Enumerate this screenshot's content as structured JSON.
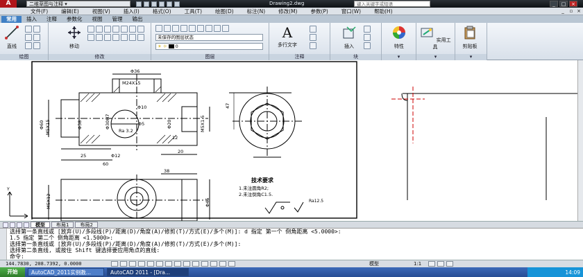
{
  "titlebar": {
    "workspace": "二维草图与注释",
    "doc_title": "Drawing2.dwg",
    "search_placeholder": "键入关键字或短语",
    "min": "_",
    "max": "□",
    "close": "×"
  },
  "menubar": {
    "items": [
      "文件(F)",
      "编辑(E)",
      "视图(V)",
      "插入(I)",
      "格式(O)",
      "工具(T)",
      "绘图(D)",
      "标注(N)",
      "修改(M)",
      "参数(P)",
      "窗口(W)",
      "帮助(H)"
    ]
  },
  "ribbon_tabs": [
    "常用",
    "插入",
    "注释",
    "参数化",
    "视图",
    "管理",
    "输出"
  ],
  "ribbon": {
    "draw": {
      "line": "直线",
      "title": "绘图"
    },
    "modify": {
      "move": "移动",
      "title": "修改"
    },
    "layers": {
      "layer_state": "未保存的图层状态",
      "layer_current": "0",
      "title": "图层"
    },
    "annotation": {
      "mtext": "多行文字",
      "title": "注释"
    },
    "block": {
      "insert": "插入",
      "title": "块"
    },
    "properties": {
      "label": "特性"
    },
    "utilities": {
      "label": "实用工具"
    },
    "clipboard": {
      "label": "剪贴板"
    }
  },
  "drawing": {
    "dims": [
      "Φ36",
      "M24X15",
      "Φ38",
      "Φ30H7",
      "Φ5",
      "Ra 3.2",
      "Φ10",
      "Φ60",
      "Φ20",
      "M5X15",
      "M5X1.5",
      "25",
      "60",
      "20",
      "12",
      "Φ12"
    ],
    "dims_bottom": [
      "38",
      "M5X12",
      "Φ45"
    ],
    "dim_right": "47",
    "tech_req_title": "技术要求",
    "tech_req_1": "1.未注圆角R2;",
    "tech_req_2": "2.未注倒角C1.5.",
    "roughness": "Ra12.5"
  },
  "layout_tabs": [
    "模型",
    "布局1",
    "布局2"
  ],
  "cmdline": {
    "lines": [
      "选择第一条直线或 [放弃(U)/多段线(P)/距离(D)/角度(A)/修剪(T)/方式(E)/多个(M)]:  d 指定 第一个 倒角距离 <5.0000>:",
      "1.5 指定 第二个 倒角距离 <1.5000>:",
      "选择第一条直线或 [放弃(U)/多段线(P)/距离(D)/角度(A)/修剪(T)/方式(E)/多个(M)]:",
      "选择第二条直线, 或按住 Shift 键选择要应用角点的直线:",
      "命令:"
    ]
  },
  "statusbar": {
    "coords": "144.7830, 208.7392, 0.0000",
    "model": "模型",
    "scale": "1:1"
  },
  "taskbar": {
    "start": "开始",
    "tasks": [
      "AutoCAD_2011实例教...",
      "AutoCAD 2011 - [Dra..."
    ],
    "clock": "14:09"
  }
}
